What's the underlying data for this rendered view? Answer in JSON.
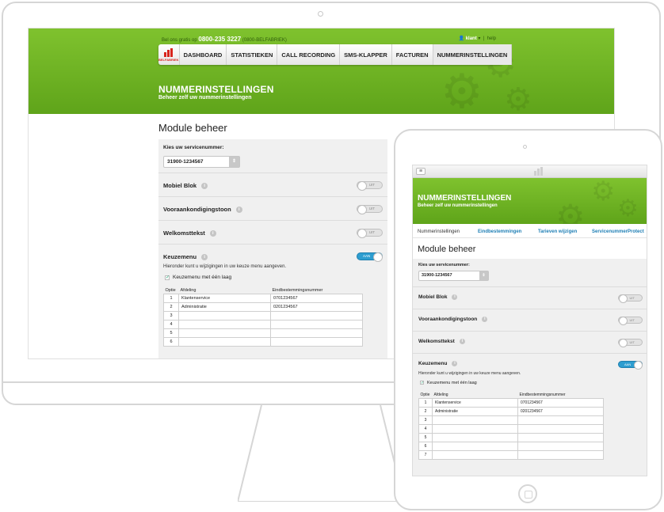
{
  "brand": {
    "logo_text": "BELFABRIEK",
    "accent": "#6cb324",
    "toggle_on": "#2d9dd0"
  },
  "desktop": {
    "top_info": {
      "call_prefix": "Bel ons gratis op",
      "phone": "0800-235 3227",
      "phone_alt": "(0800-BELFABRIEK)"
    },
    "user": {
      "name": "klant",
      "help": "help"
    },
    "nav": [
      "DASHBOARD",
      "STATISTIEKEN",
      "CALL RECORDING",
      "SMS-KLAPPER",
      "FACTUREN",
      "NUMMERINSTELLINGEN"
    ],
    "hero": {
      "title": "NUMMERINSTELLINGEN",
      "subtitle": "Beheer zelf uw nummerinstellingen"
    },
    "module_title": "Module beheer",
    "select": {
      "label": "Kies uw servicenummer:",
      "value": "31900-1234567"
    },
    "settings": [
      {
        "label": "Mobiel Blok",
        "state": "UIT"
      },
      {
        "label": "Vooraankondigingstoon",
        "state": "UIT"
      },
      {
        "label": "Welkomsttekst",
        "state": "UIT"
      },
      {
        "label": "Keuzemenu",
        "state": "AAN"
      }
    ],
    "keuzemenu": {
      "description": "Hieronder kunt u wijzigingen in uw keuze menu aangeven.",
      "checkbox_label": "Keuzemenu met één laag",
      "columns": [
        "Optie",
        "Afdeling",
        "Eindbestemmingsnummer"
      ],
      "rows": [
        [
          "1",
          "Klantenservice",
          "0701234567"
        ],
        [
          "2",
          "Administratie",
          "0201234567"
        ],
        [
          "3",
          "",
          ""
        ],
        [
          "4",
          "",
          ""
        ],
        [
          "5",
          "",
          ""
        ],
        [
          "6",
          "",
          ""
        ]
      ]
    }
  },
  "tablet": {
    "hero": {
      "title": "NUMMERINSTELLINGEN",
      "subtitle": "Beheer zelf uw nummerinstellingen"
    },
    "tabs": [
      "Nummerinstellingen",
      "Eindbestemmingen",
      "Tarieven wijzigen",
      "ServicenummerProtect"
    ],
    "module_title": "Module beheer",
    "select": {
      "label": "Kies uw servicenummer:",
      "value": "31900-1234567"
    },
    "settings": [
      {
        "label": "Mobiel Blok",
        "state": "UIT"
      },
      {
        "label": "Vooraankondigingstoon",
        "state": "UIT"
      },
      {
        "label": "Welkomsttekst",
        "state": "UIT"
      },
      {
        "label": "Keuzemenu",
        "state": "AAN"
      }
    ],
    "keuzemenu": {
      "description": "Hieronder kunt u wijzigingen in uw keuze menu aangeven.",
      "checkbox_label": "Keuzemenu met één laag",
      "columns": [
        "Optie",
        "Afdeling",
        "Eindbestemmingsnummer"
      ],
      "rows": [
        [
          "1",
          "Klantenservice",
          "0701234567"
        ],
        [
          "2",
          "Administratie",
          "0201234567"
        ],
        [
          "3",
          "",
          ""
        ],
        [
          "4",
          "",
          ""
        ],
        [
          "5",
          "",
          ""
        ],
        [
          "6",
          "",
          ""
        ],
        [
          "7",
          "",
          ""
        ]
      ]
    }
  }
}
